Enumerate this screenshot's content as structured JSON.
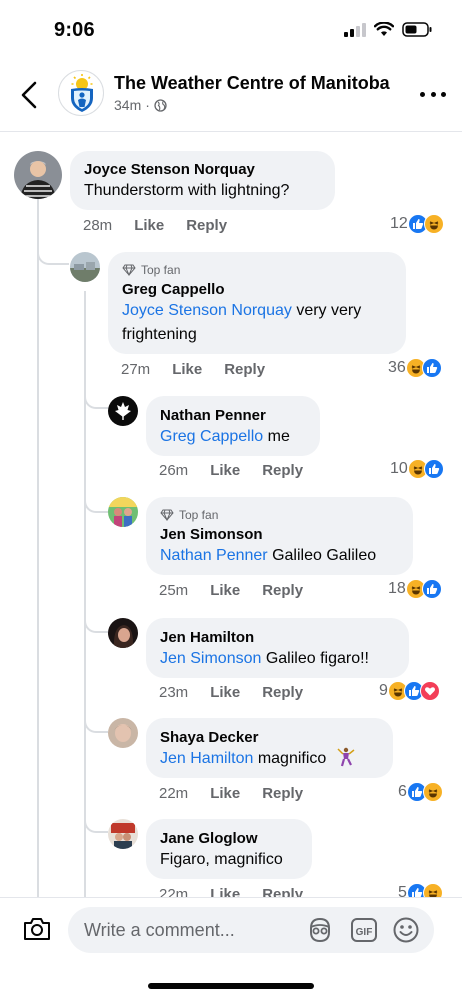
{
  "status": {
    "time": "9:06"
  },
  "header": {
    "title": "The Weather Centre of Manitoba",
    "time_ago": "34m",
    "separator": "·"
  },
  "labels": {
    "like": "Like",
    "reply": "Reply",
    "top_fan": "Top fan"
  },
  "comments": [
    {
      "author": "Joyce Stenson Norquay",
      "mention": "",
      "text": "Thunderstorm with lightning?",
      "time": "28m",
      "reaction_count": "12",
      "reactions": [
        "like",
        "haha"
      ],
      "top_fan": false
    },
    {
      "author": "Greg Cappello",
      "mention": "Joyce Stenson Norquay",
      "text": " very very frightening",
      "time": "27m",
      "reaction_count": "36",
      "reactions": [
        "haha",
        "like"
      ],
      "top_fan": true
    },
    {
      "author": "Nathan Penner",
      "mention": "Greg Cappello",
      "text": " me",
      "time": "26m",
      "reaction_count": "10",
      "reactions": [
        "haha",
        "like"
      ],
      "top_fan": false
    },
    {
      "author": "Jen Simonson",
      "mention": "Nathan Penner",
      "text": " Galileo Galileo",
      "time": "25m",
      "reaction_count": "18",
      "reactions": [
        "haha",
        "like"
      ],
      "top_fan": true
    },
    {
      "author": "Jen Hamilton",
      "mention": "Jen Simonson",
      "text": " Galileo figaro!!",
      "time": "23m",
      "reaction_count": "9",
      "reactions": [
        "haha",
        "like",
        "love"
      ],
      "top_fan": false
    },
    {
      "author": "Shaya Decker",
      "mention": "Jen Hamilton",
      "text": " magnifico",
      "time": "22m",
      "reaction_count": "6",
      "reactions": [
        "like",
        "haha"
      ],
      "top_fan": false
    },
    {
      "author": "Jane Gloglow",
      "mention": "",
      "text": "Figaro, magnifico",
      "time": "22m",
      "reaction_count": "5",
      "reactions": [
        "like",
        "haha"
      ],
      "top_fan": false
    }
  ],
  "composer": {
    "placeholder": "Write a comment..."
  },
  "colors": {
    "accent": "#1877f2",
    "mention": "#1b74e4",
    "bubble": "#f0f2f5",
    "haha": "#f7b125",
    "love": "#f33e58"
  }
}
